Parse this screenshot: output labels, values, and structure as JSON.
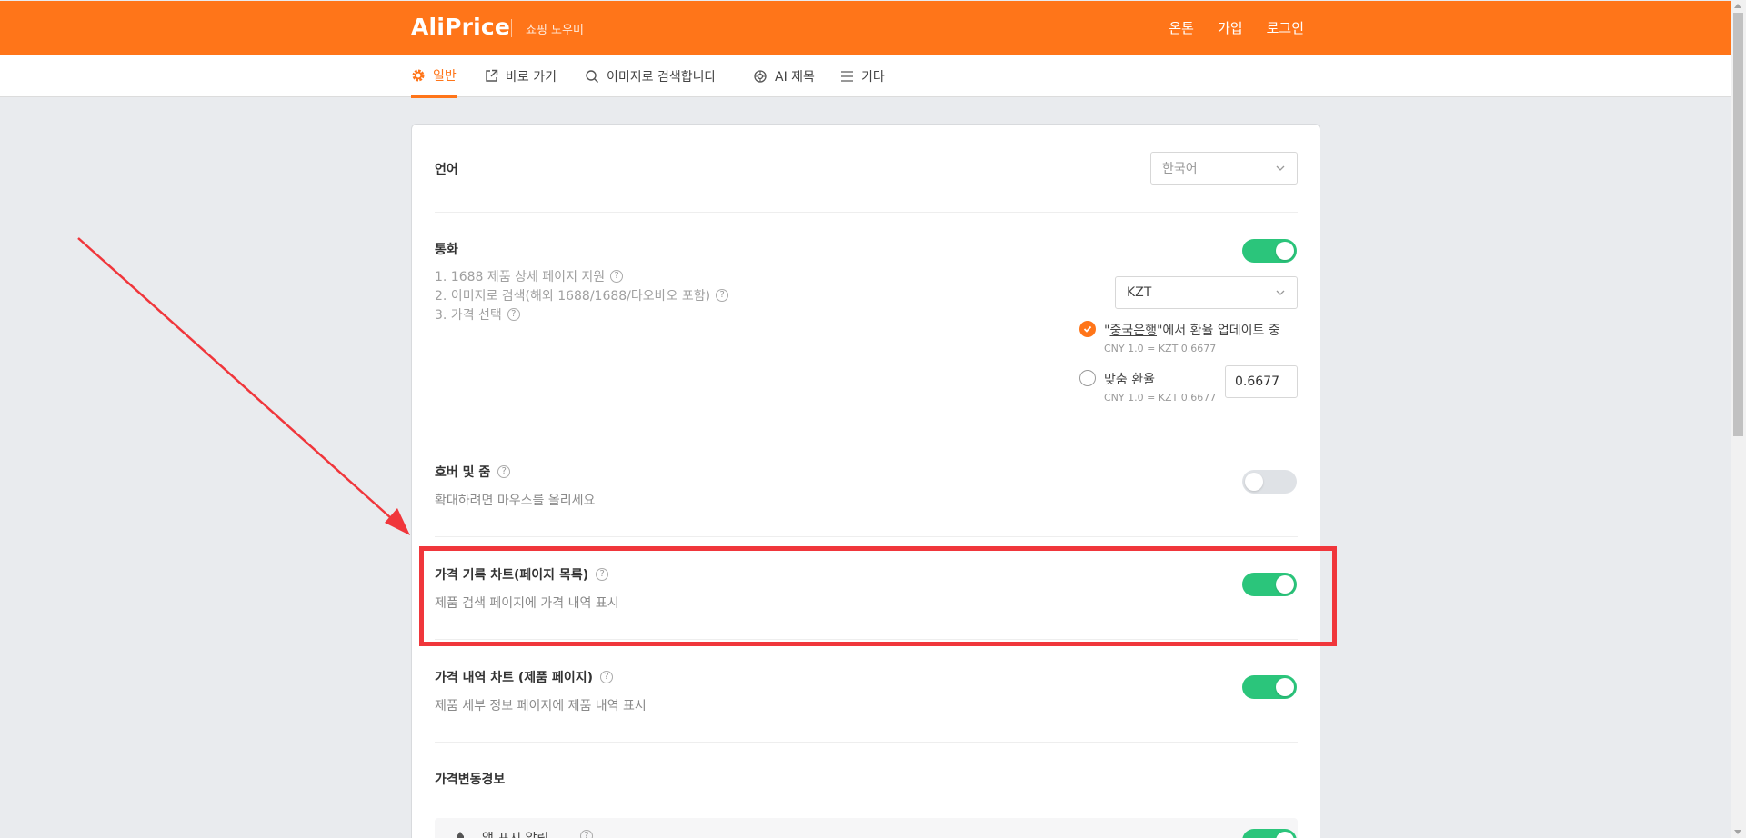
{
  "header": {
    "logo": "AliPrice",
    "tagline": "쇼핑 도우미",
    "links": [
      "온톤",
      "가입",
      "로그인"
    ]
  },
  "nav": {
    "items": [
      {
        "label": "일반",
        "icon": "gear-icon",
        "active": true
      },
      {
        "label": "바로 가기",
        "icon": "external-link-icon",
        "active": false
      },
      {
        "label": "이미지로 검색합니다",
        "icon": "search-icon",
        "active": false
      },
      {
        "label": "AI 제목",
        "icon": "ai-icon",
        "active": false
      },
      {
        "label": "기타",
        "icon": "menu-icon",
        "active": false
      }
    ]
  },
  "settings": {
    "language": {
      "title": "언어",
      "selected": "한국어"
    },
    "currency": {
      "title": "통화",
      "enabled": true,
      "features": [
        "1. 1688 제품 상세 페이지 지원",
        "2. 이미지로 검색(해외 1688/1688/타오바오 포함)",
        "3. 가격 선택"
      ],
      "selected": "KZT",
      "option_bank": {
        "prefix": "\"",
        "bank": "중국은행",
        "suffix": "\"에서 환율 업데이트 중",
        "rate": "CNY 1.0 = KZT 0.6677",
        "checked": true
      },
      "option_custom": {
        "label": "맞춤 환율",
        "rate": "CNY 1.0 = KZT 0.6677",
        "value": "0.6677",
        "checked": false
      }
    },
    "hover_zoom": {
      "title": "호버 및 줌",
      "desc": "확대하려면 마우스를 올리세요",
      "enabled": false
    },
    "price_chart_list": {
      "title": "가격 기록 차트(페이지 목록)",
      "desc": "제품 검색 페이지에 가격 내역 표시",
      "enabled": true
    },
    "price_chart_product": {
      "title": "가격 내역 차트 (제품 페이지)",
      "desc": "제품 세부 정보 페이지에 제품 내역 표시",
      "enabled": true
    },
    "price_alert": {
      "title": "가격변동경보",
      "item_label": "앱 표시 알림",
      "enabled": true
    }
  },
  "colors": {
    "brand": "#ff7519",
    "toggle_on": "#2bc57b",
    "annotation": "#f0363b"
  }
}
